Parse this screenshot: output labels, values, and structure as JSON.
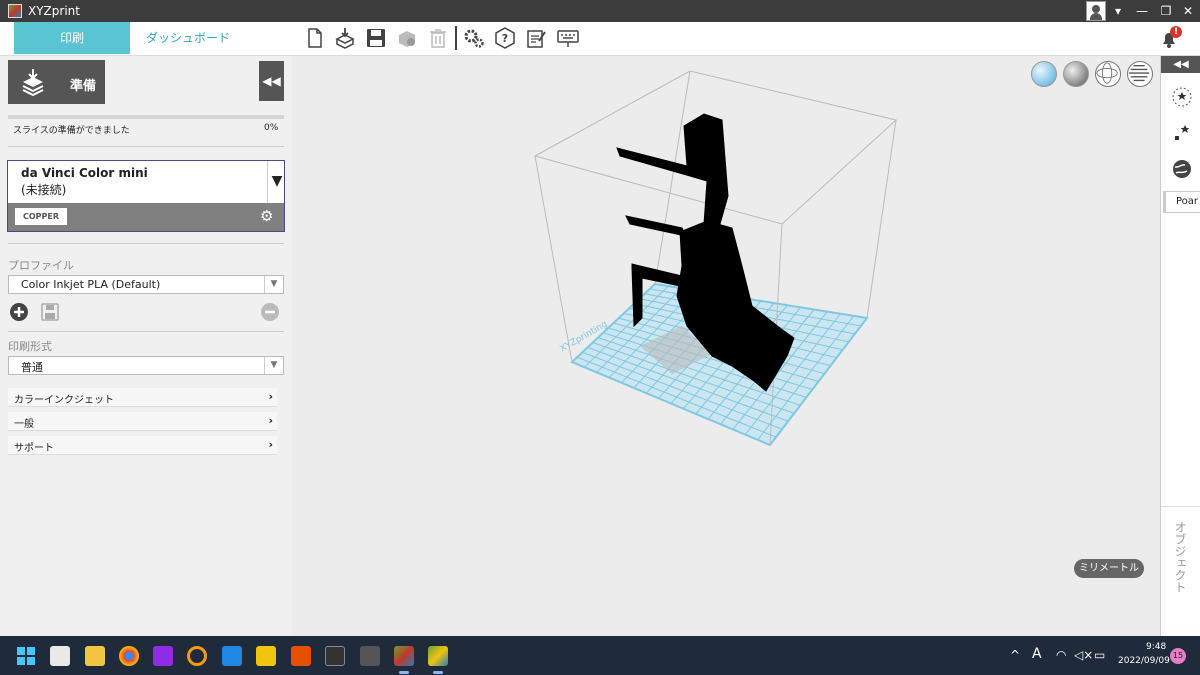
{
  "window": {
    "title": "XYZprint"
  },
  "tabs": {
    "print": "印刷",
    "dashboard": "ダッシュボード"
  },
  "toolbar": {
    "icons": [
      "new-file-icon",
      "import-icon",
      "save-icon",
      "object-settings-icon",
      "trash-icon",
      "settings-icon",
      "help-icon",
      "notes-icon",
      "keyboard-icon"
    ],
    "notification_badge": "!"
  },
  "left": {
    "prepare_label": "準備",
    "collapse_glyph": "◀◀",
    "progress_text": "スライスの準備ができました",
    "progress_pct": "0%",
    "progress_fraction": 0,
    "printer": {
      "name": "da Vinci Color mini",
      "status": "(未接続)",
      "material": "COPPER"
    },
    "profile_label": "プロファイル",
    "profile_value": "Color Inkjet PLA (Default)",
    "print_mode_label": "印刷形式",
    "print_mode_value": "普通",
    "sections": [
      "カラーインクジェット",
      "一般",
      "サポート"
    ]
  },
  "viewport": {
    "unit_button": "ミリメートル",
    "plate_label": "XYZprinting",
    "view_buttons": [
      "color-view-icon",
      "solid-view-icon",
      "wireframe-view-icon",
      "layer-view-icon"
    ]
  },
  "right": {
    "collapse_glyph": "◀◀",
    "poar_text": "Poar",
    "objects_label": "オブジェクト"
  },
  "taskbar": {
    "time": "9:48",
    "date": "2022/09/09",
    "notifications": "15",
    "ime": "A",
    "caret": "^"
  },
  "colors": {
    "accent": "#5bc4d3",
    "dark": "#555555",
    "taskbar": "#1f2a3a",
    "plate": "#7ec8e3"
  }
}
